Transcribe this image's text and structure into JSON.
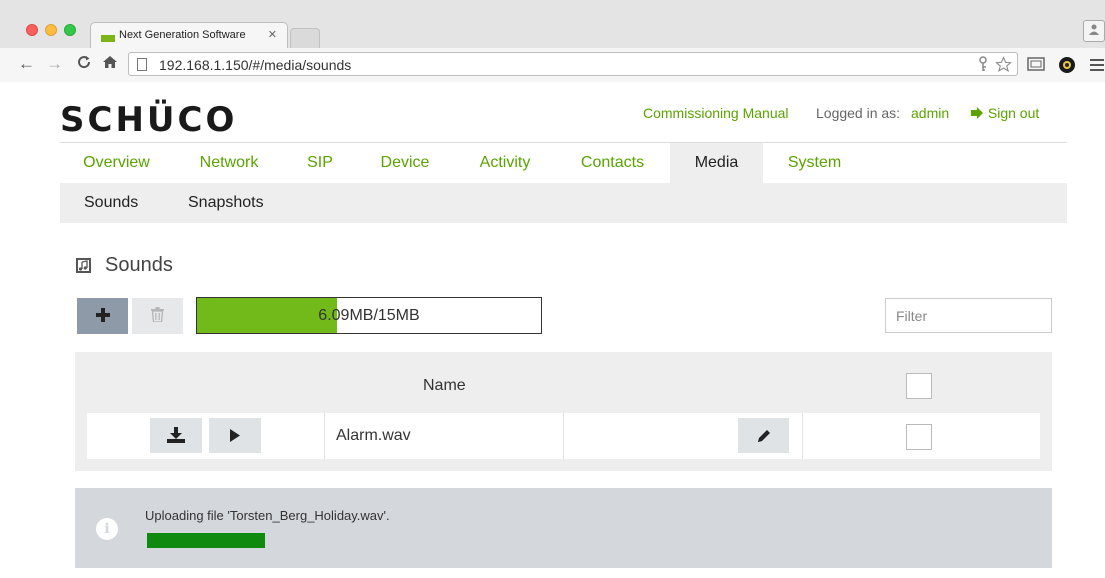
{
  "browser": {
    "tab_title": "Next Generation Software",
    "tab_close": "✕",
    "url": "192.168.1.150/#/media/sounds"
  },
  "header": {
    "logo_text": "SCHÜCO",
    "commissioning_manual": "Commissioning Manual",
    "logged_in_label": "Logged in as:",
    "username": "admin",
    "sign_out": "Sign out"
  },
  "main_tabs": [
    {
      "label": "Overview"
    },
    {
      "label": "Network"
    },
    {
      "label": "SIP"
    },
    {
      "label": "Device"
    },
    {
      "label": "Activity"
    },
    {
      "label": "Contacts"
    },
    {
      "label": "Media",
      "active": true
    },
    {
      "label": "System"
    }
  ],
  "sub_nav": [
    {
      "label": "Sounds"
    },
    {
      "label": "Snapshots"
    }
  ],
  "section": {
    "title": "Sounds"
  },
  "toolbar": {
    "add_icon": "plus-icon",
    "delete_icon": "trash-icon",
    "storage_text": "6.09MB/15MB",
    "storage_fraction": 0.406,
    "filter_placeholder": "Filter"
  },
  "table": {
    "header_name": "Name",
    "rows": [
      {
        "name": "Alarm.wav"
      }
    ]
  },
  "alert": {
    "message": "Uploading file 'Torsten_Berg_Holiday.wav'.",
    "progress_fraction": 1.0
  },
  "colors": {
    "brand_green": "#5aa300",
    "storage_fill": "#72ba1a",
    "upload_fill": "#0f8a0f"
  }
}
